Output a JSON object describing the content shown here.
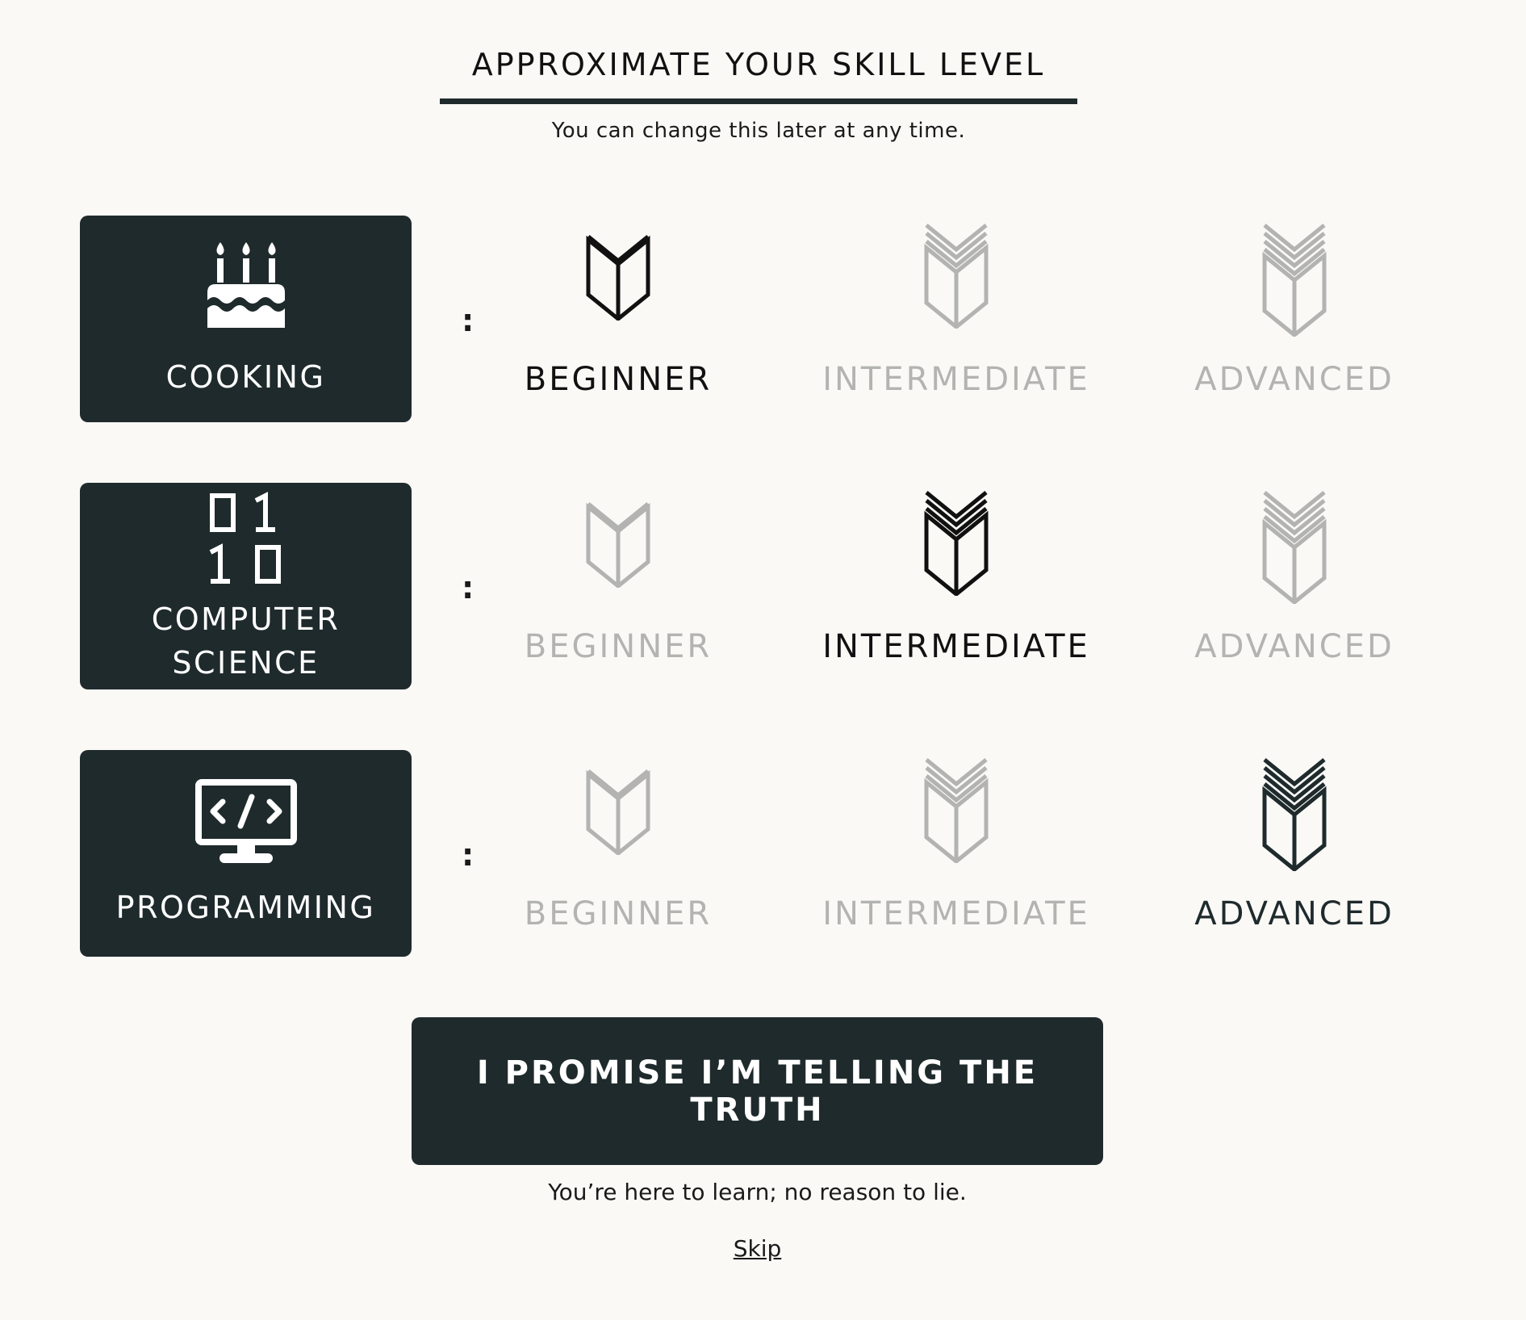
{
  "header": {
    "title": "APPROXIMATE YOUR SKILL LEVEL",
    "subtitle": "You can change this later at any time."
  },
  "separator": ":",
  "rows": [
    {
      "category": {
        "label": "COOKING",
        "icon": "birthday-cake-icon"
      },
      "selected": "BEGINNER",
      "levels": [
        "BEGINNER",
        "INTERMEDIATE",
        "ADVANCED"
      ]
    },
    {
      "category": {
        "label_line1": "COMPUTER",
        "label_line2": "SCIENCE",
        "icon": "binary-digits-icon",
        "icon_text_1": "0 1",
        "icon_text_2": "1 0"
      },
      "selected": "INTERMEDIATE",
      "levels": [
        "BEGINNER",
        "INTERMEDIATE",
        "ADVANCED"
      ]
    },
    {
      "category": {
        "label": "PROGRAMMING",
        "icon": "code-monitor-icon",
        "icon_text": "</>"
      },
      "selected": "ADVANCED",
      "levels": [
        "BEGINNER",
        "INTERMEDIATE",
        "ADVANCED"
      ]
    }
  ],
  "cta": {
    "label": "I PROMISE I’M TELLING THE TRUTH"
  },
  "note": "You’re here to learn; no reason to lie.",
  "skip": "Skip",
  "colors": {
    "dark": "#1f2a2c",
    "selected_text": "#111111",
    "unselected_text": "#b3b3b1",
    "background": "#faf9f6"
  }
}
